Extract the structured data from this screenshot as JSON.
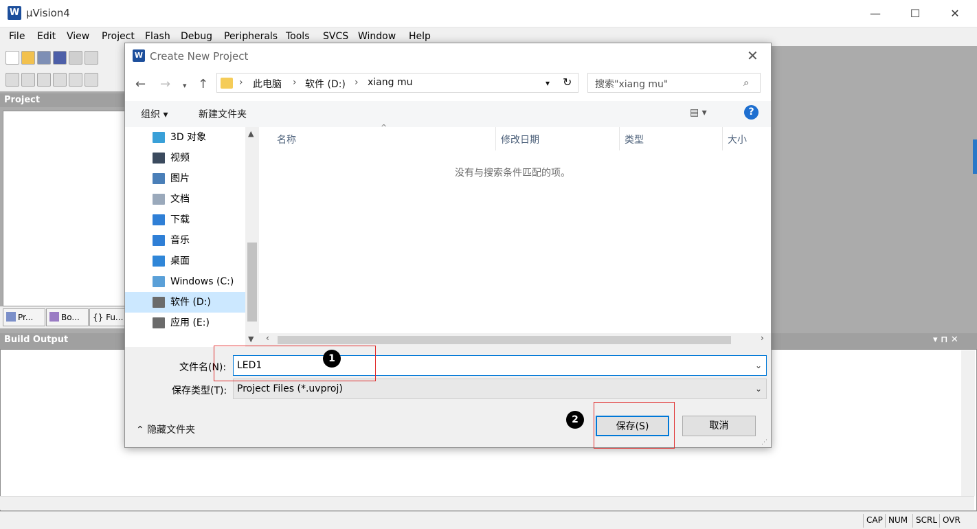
{
  "app": {
    "title": "µVision4",
    "icon_glyph": "W"
  },
  "window_controls": {
    "minimize": "—",
    "maximize": "☐",
    "close": "✕"
  },
  "menu": [
    "File",
    "Edit",
    "View",
    "Project",
    "Flash",
    "Debug",
    "Peripherals",
    "Tools",
    "SVCS",
    "Window",
    "Help"
  ],
  "project_panel": {
    "title": "Project",
    "tabs": [
      "Pr...",
      "Bo...",
      "{} Fu..."
    ]
  },
  "build_panel": {
    "title": "Build Output",
    "controls": "▾ ⊓ ✕"
  },
  "statusbar": [
    "CAP",
    "NUM",
    "SCRL",
    "OVR"
  ],
  "dialog": {
    "title": "Create New Project",
    "breadcrumb": [
      "此电脑",
      "软件 (D:)",
      "xiang mu"
    ],
    "search_placeholder": "搜索\"xiang mu\"",
    "organize": "组织 ▾",
    "new_folder": "新建文件夹",
    "view_glyph": "▤ ▾",
    "help_glyph": "?",
    "tree": [
      {
        "label": "3D 对象",
        "icon": "cube-icon",
        "color": "#39a0d8"
      },
      {
        "label": "视频",
        "icon": "film-icon",
        "color": "#3b4a5e"
      },
      {
        "label": "图片",
        "icon": "picture-icon",
        "color": "#4a7fb8"
      },
      {
        "label": "文档",
        "icon": "document-icon",
        "color": "#9aa9bb"
      },
      {
        "label": "下载",
        "icon": "download-icon",
        "color": "#2f7fd6"
      },
      {
        "label": "音乐",
        "icon": "music-icon",
        "color": "#2f7fd6"
      },
      {
        "label": "桌面",
        "icon": "desktop-icon",
        "color": "#2f86d8"
      },
      {
        "label": "Windows (C:)",
        "icon": "drive-windows-icon",
        "color": "#5aa0d8"
      },
      {
        "label": "软件 (D:)",
        "icon": "drive-icon",
        "color": "#6b6b6b",
        "selected": true
      },
      {
        "label": "应用 (E:)",
        "icon": "drive-icon",
        "color": "#6b6b6b"
      }
    ],
    "columns": [
      "名称",
      "修改日期",
      "类型",
      "大小"
    ],
    "empty_message": "没有与搜索条件匹配的项。",
    "filename_label": "文件名(N):",
    "filename_value": "LED1",
    "filetype_label": "保存类型(T):",
    "filetype_value": "Project Files (*.uvproj)",
    "hide_folders": "隐藏文件夹",
    "save_button": "保存(S)",
    "cancel_button": "取消"
  },
  "callouts": [
    "1",
    "2"
  ]
}
